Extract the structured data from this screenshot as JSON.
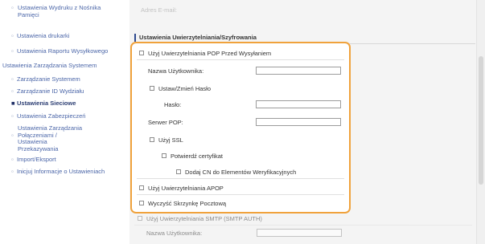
{
  "sidebar": {
    "items": [
      {
        "label": "Ustawienia Wydruku z Nośnika Pamięci",
        "type": "multi"
      },
      {
        "label": "Ustawienia drukarki",
        "type": "item"
      },
      {
        "label": "Ustawienia Raportu Wysyłkowego",
        "type": "item"
      },
      {
        "label": "Ustawienia Zarządzania Systemem",
        "type": "heading"
      },
      {
        "label": "Zarządzanie Systemem",
        "type": "item"
      },
      {
        "label": "Zarządzanie ID Wydziału",
        "type": "item"
      },
      {
        "label": "Ustawienia Sieciowe",
        "type": "item-active"
      },
      {
        "label": "Ustawienia Zabezpieczeń",
        "type": "item"
      },
      {
        "label": "Ustawienia Zarządzania Połączeniami / Ustawienia Przekazywania",
        "type": "multi"
      },
      {
        "label": "Import/Eksport",
        "type": "item"
      },
      {
        "label": "Inicjuj Informacje o Ustawieniach",
        "type": "item"
      }
    ]
  },
  "main": {
    "top_field_label": "Adres E-mail:",
    "section_title": "Ustawienia Uwierzytelniania/Szyfrowania",
    "pop": {
      "use_pop_label": "Użyj Uwierzytelniania POP Przed Wysyłaniem",
      "username_label": "Nazwa Użytkownika:",
      "username_value": "",
      "set_change_password_label": "Ustaw/Zmień Hasło",
      "password_label": "Hasło:",
      "password_value": "",
      "pop_server_label": "Serwer POP:",
      "pop_server_value": "",
      "use_ssl_label": "Użyj SSL",
      "confirm_cert_label": "Potwierdź certyfikat",
      "add_cn_label": "Dodaj CN do Elementów Weryfikacyjnych",
      "use_apop_label": "Użyj Uwierzytelniania APOP",
      "clear_mailbox_label": "Wyczyść Skrzynkę Pocztową"
    },
    "smtp": {
      "use_smtp_label": "Użyj Uwierzytelniania SMTP (SMTP AUTH)",
      "username_label": "Nazwa Użytkownika:"
    }
  },
  "colors": {
    "highlight_border": "#f0a23c",
    "link": "#4b66a8",
    "section_marker": "#2e4a8f"
  }
}
